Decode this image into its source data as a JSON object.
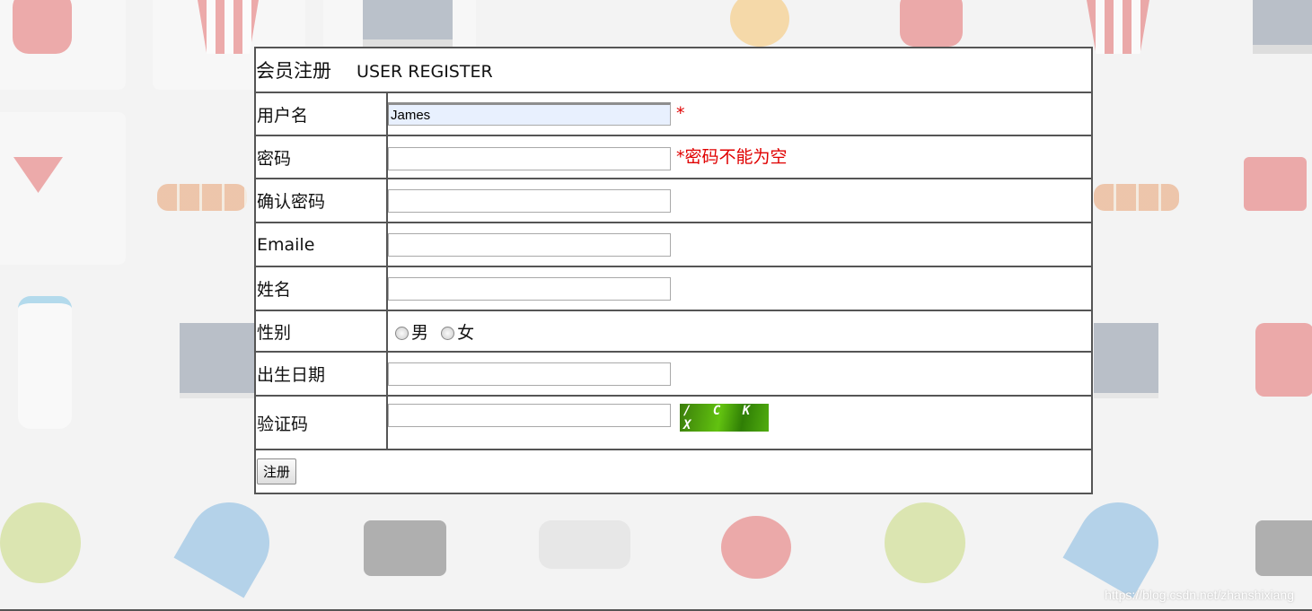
{
  "form": {
    "title_cn": "会员注册",
    "title_en": "USER REGISTER",
    "rows": {
      "username": {
        "label": "用户名",
        "value": "James",
        "marker": "*"
      },
      "password": {
        "label": "密码",
        "value": "",
        "error": "*密码不能为空"
      },
      "confirm_password": {
        "label": "确认密码",
        "value": ""
      },
      "email": {
        "label": "Emaile",
        "value": ""
      },
      "name": {
        "label": "姓名",
        "value": ""
      },
      "gender": {
        "label": "性别",
        "options": [
          "男",
          "女"
        ]
      },
      "birthday": {
        "label": "出生日期",
        "value": ""
      },
      "captcha": {
        "label": "验证码",
        "value": "",
        "image_text": "/ C K X"
      }
    },
    "submit_label": "注册"
  },
  "watermark": "https://blog.csdn.net/zhanshixiang",
  "colors": {
    "error": "#e00000",
    "autofill": "#e8f0fe",
    "border": "#555555"
  }
}
